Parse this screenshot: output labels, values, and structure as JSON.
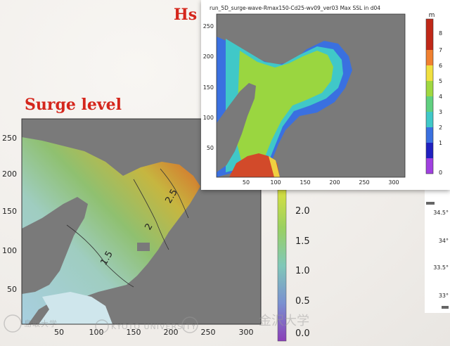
{
  "slide": {
    "hs_title": "Hs",
    "surge_title": "Surge level"
  },
  "chart_data": [
    {
      "type": "heatmap",
      "id": "surge-level-map",
      "title": "",
      "xticks": [
        50,
        100,
        150,
        200,
        250,
        300
      ],
      "yticks": [
        50,
        100,
        150,
        200,
        250
      ],
      "xlim": [
        0,
        320
      ],
      "ylim": [
        0,
        270
      ],
      "colorbar": {
        "ticks": [
          "0.0",
          "0.5",
          "1.0",
          "1.5",
          "2.0"
        ],
        "range": [
          0,
          2.6
        ]
      },
      "contours": [
        {
          "value": "1.5",
          "label": "1.5"
        },
        {
          "value": "2",
          "label": "2"
        },
        {
          "value": "2.5",
          "label": "2.5"
        }
      ],
      "colors": {
        "land": "#7a7a7a",
        "low": "#9fc8dd",
        "mid": "#8fbf6a",
        "high": "#c93a24"
      }
    },
    {
      "type": "heatmap",
      "id": "hs-map",
      "title": "run_5D_surge-wave-Rmax150-Cd25-wv09_ver03 Max SSL in d04",
      "xticks": [
        50,
        100,
        150,
        200,
        250,
        300
      ],
      "yticks": [
        50,
        100,
        150,
        200,
        250
      ],
      "xlim": [
        0,
        320
      ],
      "ylim": [
        0,
        290
      ],
      "colorbar": {
        "unit": "m",
        "ticks": [
          "0",
          "1",
          "2",
          "3",
          "4",
          "5",
          "6",
          "7",
          "8"
        ],
        "range": [
          0,
          9
        ]
      },
      "colors": {
        "land": "#7a7a7a",
        "c0": "#8a2be2",
        "c1": "#2020c0",
        "c2": "#3a70e0",
        "c3": "#40c8c8",
        "c4": "#60d080",
        "c5": "#a0d840",
        "c6": "#f0e040",
        "c7": "#f08030",
        "c8": "#c02818"
      }
    }
  ],
  "side_strip": {
    "ticks": [
      "34.5°",
      "34°",
      "33.5°",
      "33°"
    ]
  },
  "logos": {
    "logo1": "島取大学",
    "logo2": "KYOTO UNIVERSITY",
    "logo3": "金沢大学"
  }
}
